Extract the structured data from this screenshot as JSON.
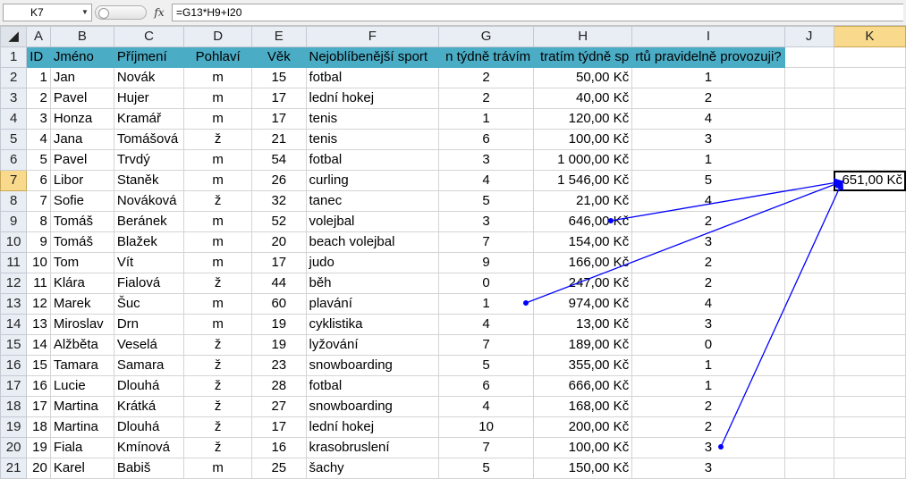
{
  "formula_bar": {
    "name_box": "K7",
    "fx_label": "fx",
    "formula": "=G13*H9+I20"
  },
  "columns": [
    "A",
    "B",
    "C",
    "D",
    "E",
    "F",
    "G",
    "H",
    "I",
    "J",
    "K"
  ],
  "active_column": "K",
  "active_row": 7,
  "headers": {
    "id": "ID",
    "first_name": "Jméno",
    "last_name": "Příjmení",
    "gender": "Pohlaví",
    "age": "Věk",
    "sport": "Nejoblíbenější sport",
    "hours": "n týdně trávím",
    "cost": "tratím týdně sp",
    "count": "rtů pravidelně provozuji?"
  },
  "rows": [
    {
      "row": "2",
      "id": "1",
      "first": "Jan",
      "last": "Novák",
      "gender": "m",
      "age": "15",
      "sport": "fotbal",
      "hours": "2",
      "cost": "50,00 Kč",
      "count": "1"
    },
    {
      "row": "3",
      "id": "2",
      "first": "Pavel",
      "last": "Hujer",
      "gender": "m",
      "age": "17",
      "sport": "lední hokej",
      "hours": "2",
      "cost": "40,00 Kč",
      "count": "2"
    },
    {
      "row": "4",
      "id": "3",
      "first": "Honza",
      "last": "Kramář",
      "gender": "m",
      "age": "17",
      "sport": "tenis",
      "hours": "1",
      "cost": "120,00 Kč",
      "count": "4"
    },
    {
      "row": "5",
      "id": "4",
      "first": "Jana",
      "last": "Tomášová",
      "gender": "ž",
      "age": "21",
      "sport": "tenis",
      "hours": "6",
      "cost": "100,00 Kč",
      "count": "3"
    },
    {
      "row": "6",
      "id": "5",
      "first": "Pavel",
      "last": "Trvdý",
      "gender": "m",
      "age": "54",
      "sport": "fotbal",
      "hours": "3",
      "cost": "1 000,00 Kč",
      "count": "1"
    },
    {
      "row": "7",
      "id": "6",
      "first": "Libor",
      "last": "Staněk",
      "gender": "m",
      "age": "26",
      "sport": "curling",
      "hours": "4",
      "cost": "1 546,00 Kč",
      "count": "5"
    },
    {
      "row": "8",
      "id": "7",
      "first": "Sofie",
      "last": "Nováková",
      "gender": "ž",
      "age": "32",
      "sport": "tanec",
      "hours": "5",
      "cost": "21,00 Kč",
      "count": "4"
    },
    {
      "row": "9",
      "id": "8",
      "first": "Tomáš",
      "last": "Beránek",
      "gender": "m",
      "age": "52",
      "sport": "volejbal",
      "hours": "3",
      "cost": "646,00 Kč",
      "count": "2"
    },
    {
      "row": "10",
      "id": "9",
      "first": "Tomáš",
      "last": "Blažek",
      "gender": "m",
      "age": "20",
      "sport": "beach volejbal",
      "hours": "7",
      "cost": "154,00 Kč",
      "count": "3"
    },
    {
      "row": "11",
      "id": "10",
      "first": "Tom",
      "last": "Vít",
      "gender": "m",
      "age": "17",
      "sport": "judo",
      "hours": "9",
      "cost": "166,00 Kč",
      "count": "2"
    },
    {
      "row": "12",
      "id": "11",
      "first": "Klára",
      "last": "Fialová",
      "gender": "ž",
      "age": "44",
      "sport": "běh",
      "hours": "0",
      "cost": "247,00 Kč",
      "count": "2"
    },
    {
      "row": "13",
      "id": "12",
      "first": "Marek",
      "last": "Šuc",
      "gender": "m",
      "age": "60",
      "sport": "plavání",
      "hours": "1",
      "cost": "974,00 Kč",
      "count": "4"
    },
    {
      "row": "14",
      "id": "13",
      "first": "Miroslav",
      "last": "Drn",
      "gender": "m",
      "age": "19",
      "sport": "cyklistika",
      "hours": "4",
      "cost": "13,00 Kč",
      "count": "3"
    },
    {
      "row": "15",
      "id": "14",
      "first": "Alžběta",
      "last": "Veselá",
      "gender": "ž",
      "age": "19",
      "sport": "lyžování",
      "hours": "7",
      "cost": "189,00 Kč",
      "count": "0"
    },
    {
      "row": "16",
      "id": "15",
      "first": "Tamara",
      "last": "Samara",
      "gender": "ž",
      "age": "23",
      "sport": "snowboarding",
      "hours": "5",
      "cost": "355,00 Kč",
      "count": "1"
    },
    {
      "row": "17",
      "id": "16",
      "first": "Lucie",
      "last": "Dlouhá",
      "gender": "ž",
      "age": "28",
      "sport": "fotbal",
      "hours": "6",
      "cost": "666,00 Kč",
      "count": "1"
    },
    {
      "row": "18",
      "id": "17",
      "first": "Martina",
      "last": "Krátká",
      "gender": "ž",
      "age": "27",
      "sport": "snowboarding",
      "hours": "4",
      "cost": "168,00 Kč",
      "count": "2"
    },
    {
      "row": "19",
      "id": "18",
      "first": "Martina",
      "last": "Dlouhá",
      "gender": "ž",
      "age": "17",
      "sport": "lední hokej",
      "hours": "10",
      "cost": "200,00 Kč",
      "count": "2"
    },
    {
      "row": "20",
      "id": "19",
      "first": "Fiala",
      "last": "Kmínová",
      "gender": "ž",
      "age": "16",
      "sport": "krasobruslení",
      "hours": "7",
      "cost": "100,00 Kč",
      "count": "3"
    },
    {
      "row": "21",
      "id": "20",
      "first": "Karel",
      "last": "Babiš",
      "gender": "m",
      "age": "25",
      "sport": "šachy",
      "hours": "5",
      "cost": "150,00 Kč",
      "count": "3"
    }
  ],
  "k7_value": "651,00 Kč",
  "colors": {
    "header_fill": "#4bacc6",
    "trace_arrow": "#0000ff",
    "active_heading": "#f9d98b"
  }
}
